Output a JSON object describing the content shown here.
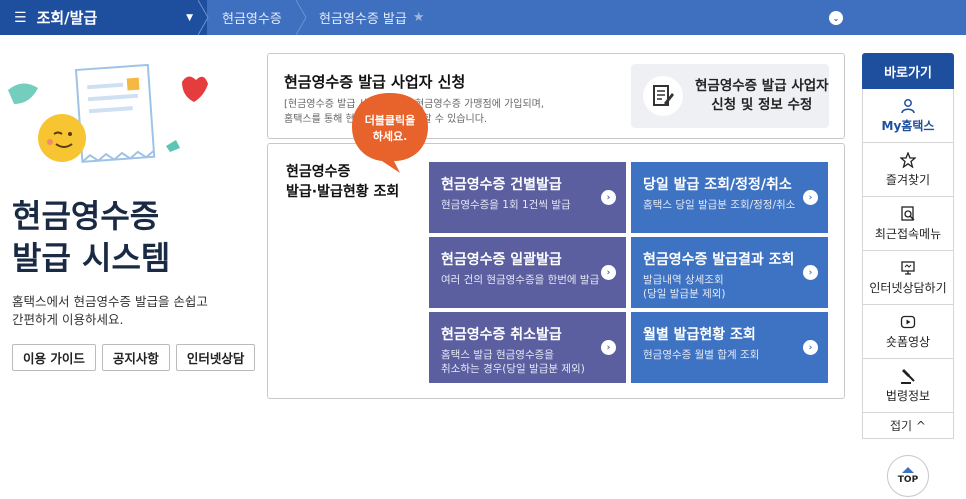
{
  "nav": {
    "menu_icon": "☰",
    "menu_label": "조회/발급",
    "caret": "▼",
    "breadcrumbs": [
      "현금영수증",
      "현금영수증 발급"
    ],
    "star": "★",
    "toggle": "⌄"
  },
  "hero": {
    "title_line1": "현금영수증",
    "title_line2": "발급 시스템",
    "desc_line1": "홈택스에서 현금영수증 발급을 손쉽고",
    "desc_line2": "간편하게 이용하세요.",
    "links": [
      "이용 가이드",
      "공지사항",
      "인터넷상담"
    ]
  },
  "apply_box": {
    "title": "현금영수증 발급 사업자 신청",
    "desc_line1": "[현금영수증 발급 사업자 신청] 현금영수증 가맹점에 가입되며,",
    "desc_line2": "홈택스를 통해 현금영수증을 발급할 수 있습니다.",
    "button_line1": "현금영수증 발급 사업자",
    "button_line2": "신청 및 정보 수정"
  },
  "issue_box": {
    "title_line1": "현금영수증",
    "title_line2": "발급·발급현황 조회",
    "bubble_line1": "더블클릭을",
    "bubble_line2": "하세요.",
    "arrow": "›",
    "tiles": [
      {
        "title": "현금영수증 건별발급",
        "desc1": "현금영수증을 1회 1건씩 발급",
        "desc2": ""
      },
      {
        "title": "당일 발급 조회/정정/취소",
        "desc1": "홈택스 당일 발급분 조회/정정/취소",
        "desc2": ""
      },
      {
        "title": "현금영수증 일괄발급",
        "desc1": "여러 건의 현금영수증을 한번에 발급",
        "desc2": ""
      },
      {
        "title": "현금영수증 발급결과 조회",
        "desc1": "발급내역 상세조회",
        "desc2": "(당일 발급분 제외)"
      },
      {
        "title": "현금영수증 취소발급",
        "desc1": "홈택스 발급 현금영수증을",
        "desc2": "취소하는 경우(당일 발급분 제외)"
      },
      {
        "title": "월별 발급현황 조회",
        "desc1": "현금영수증 월별 합계 조회",
        "desc2": ""
      }
    ]
  },
  "quick_panel": {
    "heading": "바로가기",
    "items": [
      {
        "label": "My홈택스",
        "icon": "person-icon"
      },
      {
        "label": "즐겨찾기",
        "icon": "star-icon"
      },
      {
        "label": "최근접속메뉴",
        "icon": "recent-icon"
      },
      {
        "label": "인터넷상담하기",
        "icon": "monitor-icon"
      },
      {
        "label": "숏폼영상",
        "icon": "play-icon"
      },
      {
        "label": "법령정보",
        "icon": "gavel-icon"
      }
    ],
    "fold": "접기 ^"
  },
  "top_button": "TOP",
  "colors": {
    "nav_bg": "#3f6fbf",
    "menu_bg": "#1e4f9f",
    "tile_purple": "#5b5e9f",
    "tile_blue": "#3d73c2",
    "bubble": "#e8622c"
  }
}
